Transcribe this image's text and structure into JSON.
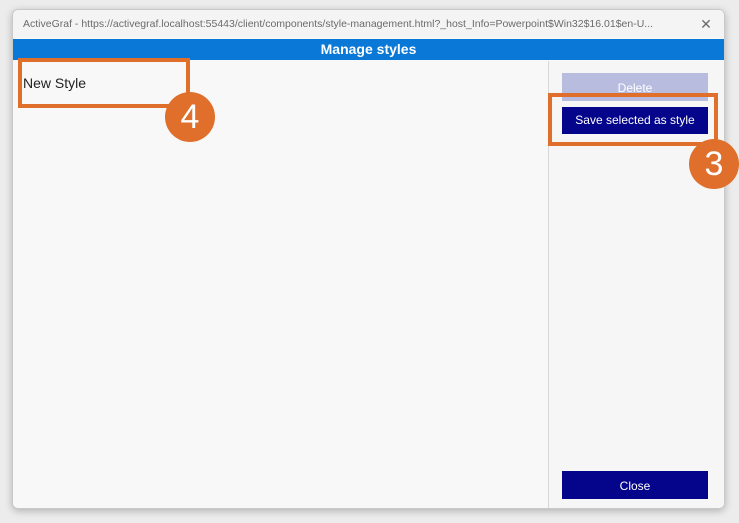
{
  "window": {
    "title": "ActiveGraf - https://activegraf.localhost:55443/client/components/style-management.html?_host_Info=Powerpoint$Win32$16.01$en-U...",
    "close_glyph": "✕"
  },
  "header": {
    "title": "Manage styles"
  },
  "style_list": {
    "items": [
      {
        "label": "New Style"
      }
    ]
  },
  "buttons": {
    "delete_label": "Delete",
    "delete_enabled": false,
    "save_label": "Save selected as style",
    "close_label": "Close"
  },
  "annotations": [
    {
      "number": "4",
      "target": "style-item-new-style"
    },
    {
      "number": "3",
      "target": "save-selected-as-style-button"
    }
  ],
  "colors": {
    "header": "#0a78d7",
    "primary_button": "#04058a",
    "disabled_button": "#b8bde0",
    "annotation": "#e06f2c"
  }
}
